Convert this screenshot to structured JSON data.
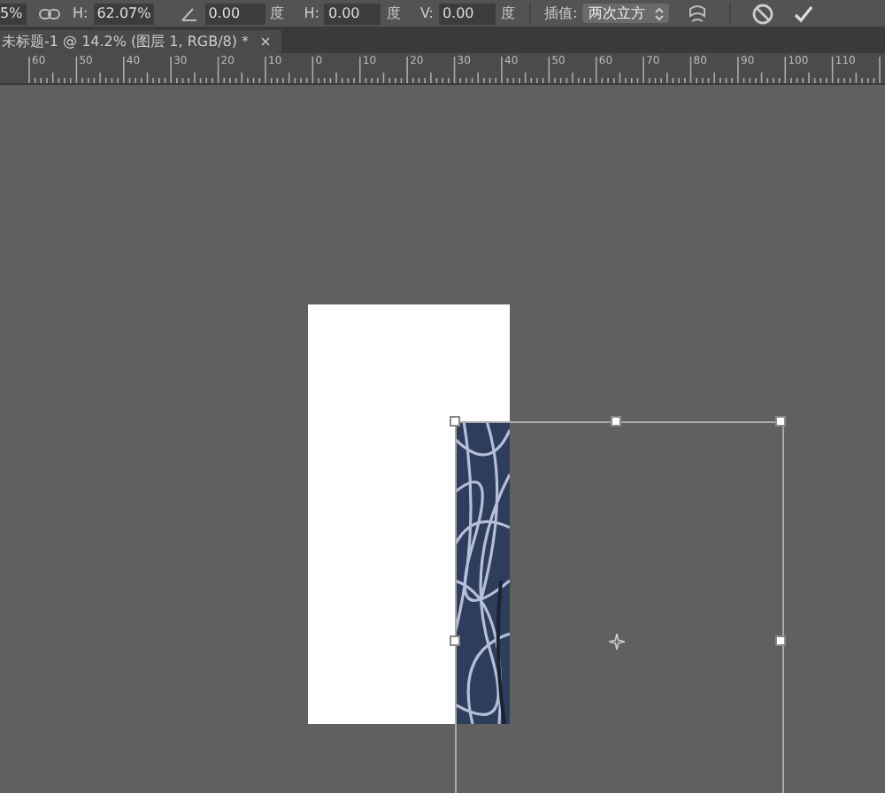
{
  "options_bar": {
    "width_value": "5%",
    "height_label": "H:",
    "height_value": "62.07%",
    "rotate_value": "0.00",
    "rotate_unit": "度",
    "hskew_label": "H:",
    "hskew_value": "0.00",
    "hskew_unit": "度",
    "vskew_label": "V:",
    "vskew_value": "0.00",
    "vskew_unit": "度",
    "interpolation_label": "插值:",
    "interpolation_value": "两次立方"
  },
  "document_tab": {
    "title": "未标题-1 @ 14.2% (图层 1, RGB/8) *",
    "close": "×"
  },
  "ruler": {
    "labels": [
      "60",
      "50",
      "40",
      "30",
      "20",
      "10",
      "0",
      "10",
      "20",
      "30",
      "40",
      "50",
      "60",
      "70",
      "80",
      "90",
      "100",
      "110"
    ]
  }
}
